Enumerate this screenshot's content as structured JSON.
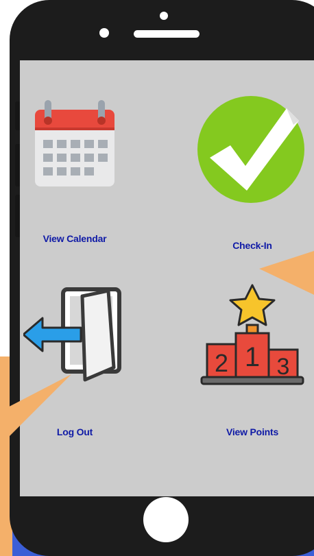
{
  "tiles": [
    {
      "label": "View Calendar",
      "icon": "calendar-icon"
    },
    {
      "label": "Check-In",
      "icon": "checkmark-icon"
    },
    {
      "label": "Log Out",
      "icon": "logout-door-icon"
    },
    {
      "label": "View Points",
      "icon": "podium-icon"
    }
  ],
  "podium": {
    "first": "1",
    "second": "2",
    "third": "3"
  },
  "colors": {
    "screen_bg": "#cccccc",
    "label": "#0f1aa6",
    "phone_body": "#1c1c1c",
    "callout": "#f4b06a",
    "accent_blue": "#3b5ed6",
    "check_green": "#84c91f",
    "calendar_red": "#e8493d",
    "podium_red": "#e84a3c",
    "star_yellow": "#f7c42b"
  }
}
